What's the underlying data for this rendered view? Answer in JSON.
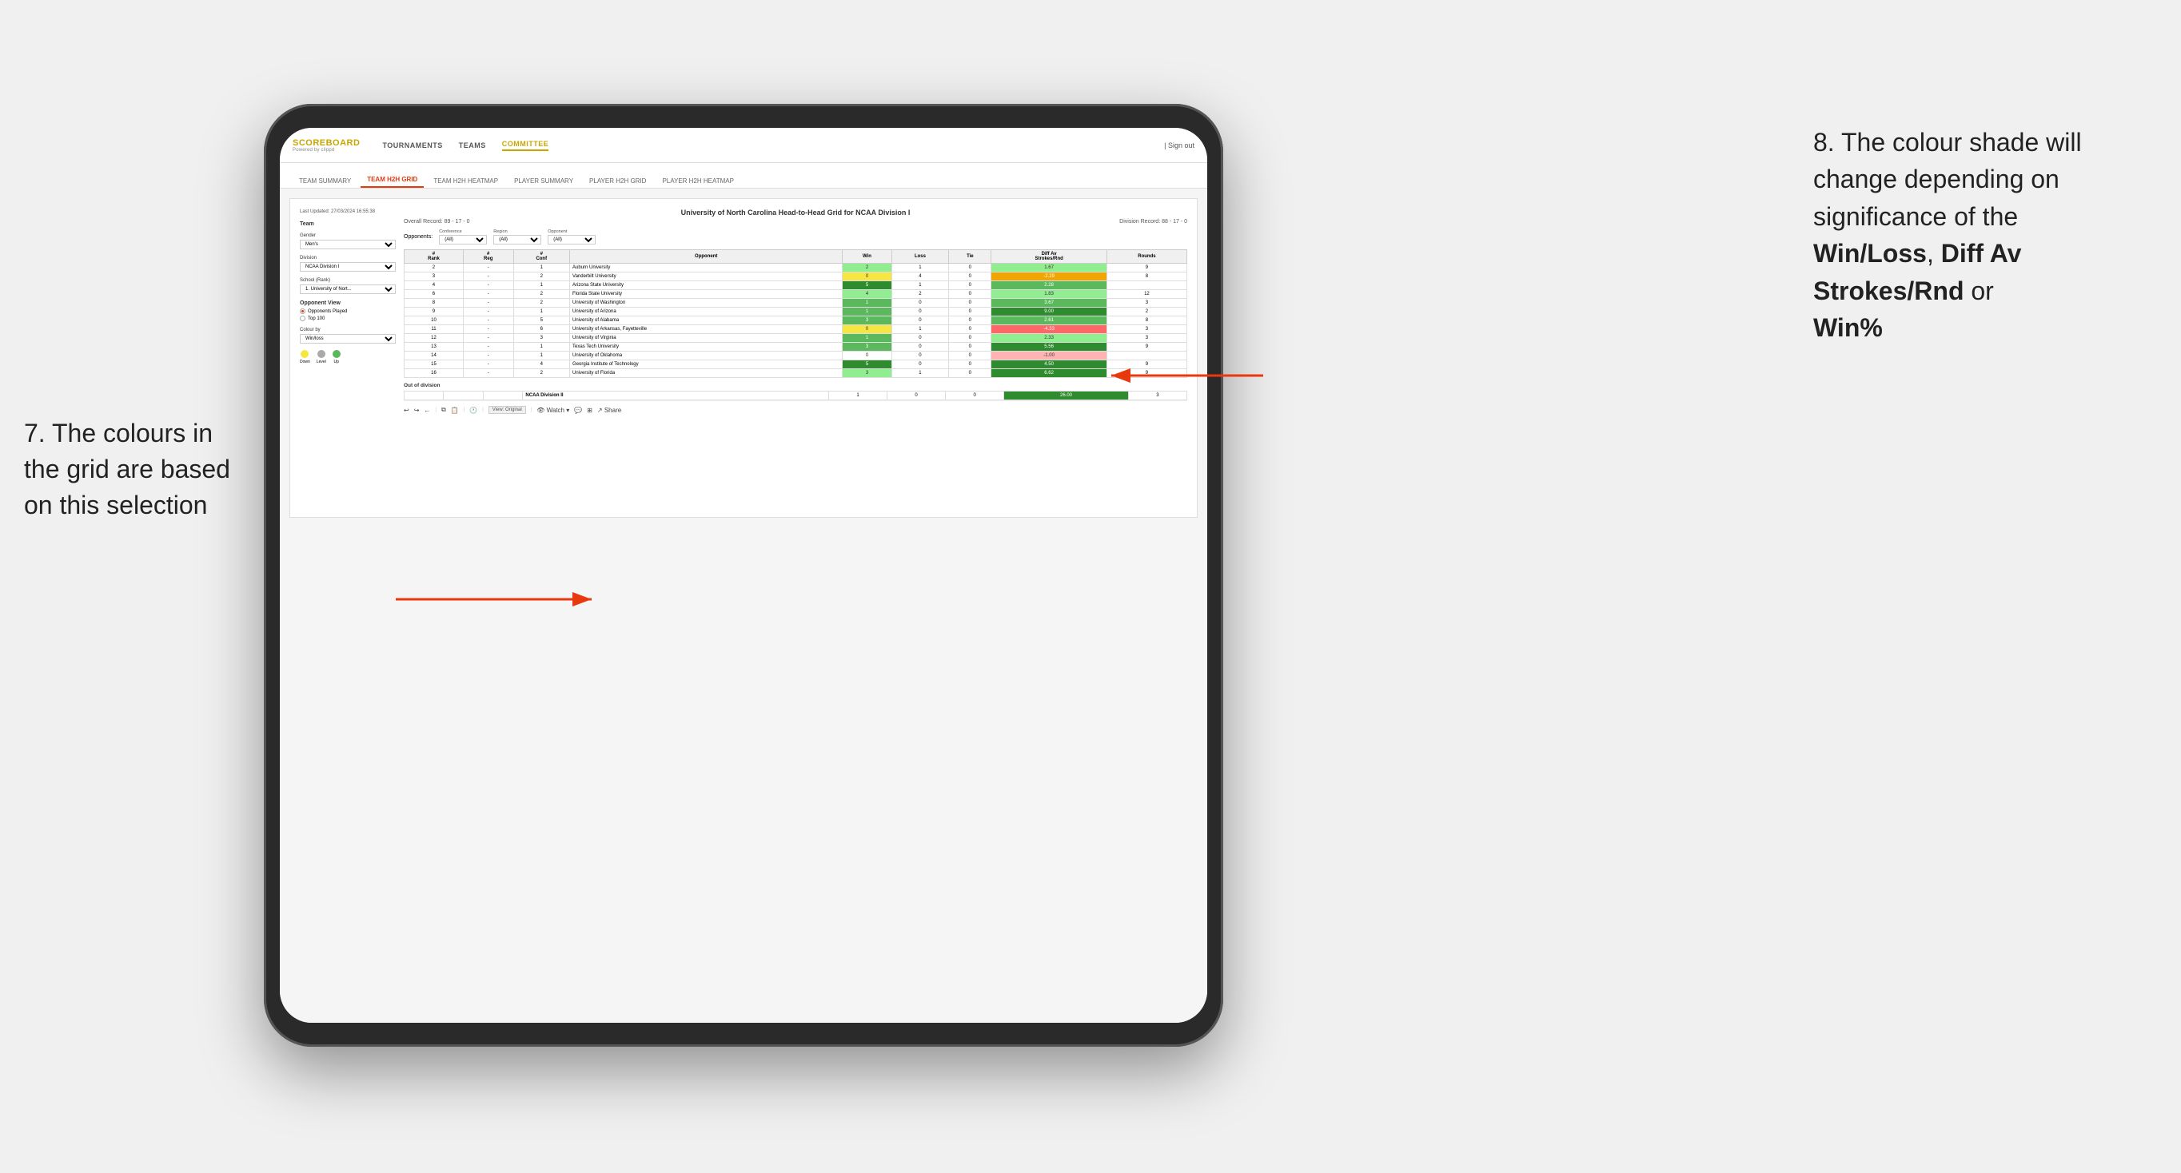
{
  "annotations": {
    "left_title": "7. The colours in the grid are based on this selection",
    "right_title": "8. The colour shade will change depending on significance of the",
    "right_bold1": "Win/Loss",
    "right_comma": ", ",
    "right_bold2": "Diff Av Strokes/Rnd",
    "right_or": " or",
    "right_bold3": "Win%"
  },
  "header": {
    "logo": "SCOREBOARD",
    "logo_sub": "Powered by clippd",
    "nav": [
      "TOURNAMENTS",
      "TEAMS",
      "COMMITTEE"
    ],
    "active_nav": "COMMITTEE",
    "sign_out": "Sign out"
  },
  "sub_nav": {
    "items": [
      "TEAM SUMMARY",
      "TEAM H2H GRID",
      "TEAM H2H HEATMAP",
      "PLAYER SUMMARY",
      "PLAYER H2H GRID",
      "PLAYER H2H HEATMAP"
    ],
    "active": "TEAM H2H GRID"
  },
  "report": {
    "last_updated": "Last Updated: 27/03/2024\n16:55:38",
    "title": "University of North Carolina Head-to-Head Grid for NCAA Division I",
    "overall_record": "Overall Record: 89 - 17 - 0",
    "division_record": "Division Record: 88 - 17 - 0",
    "sidebar": {
      "team_label": "Team",
      "gender_label": "Gender",
      "gender_value": "Men's",
      "division_label": "Division",
      "division_value": "NCAA Division I",
      "school_label": "School (Rank)",
      "school_value": "1. University of Nort...",
      "opponent_view_label": "Opponent View",
      "opponent_view_options": [
        "Opponents Played",
        "Top 100"
      ],
      "opponent_view_selected": "Opponents Played",
      "colour_by_label": "Colour by",
      "colour_by_value": "Win/loss",
      "legend": {
        "down_label": "Down",
        "level_label": "Level",
        "up_label": "Up",
        "down_color": "#f5e642",
        "level_color": "#aaaaaa",
        "up_color": "#5cb85c"
      }
    },
    "filters": {
      "conference_label": "Conference",
      "conference_value": "(All)",
      "region_label": "Region",
      "region_value": "(All)",
      "opponent_label": "Opponent",
      "opponent_value": "(All)",
      "opponents_label": "Opponents:"
    },
    "table_headers": [
      "#\nRank",
      "#\nReg",
      "#\nConf",
      "Opponent",
      "Win",
      "Loss",
      "Tie",
      "Diff Av\nStrokes/Rnd",
      "Rounds"
    ],
    "rows": [
      {
        "rank": "2",
        "reg": "-",
        "conf": "1",
        "opponent": "Auburn University",
        "win": "2",
        "loss": "1",
        "tie": "0",
        "diff": "1.67",
        "rounds": "9",
        "win_color": "green-light",
        "diff_color": "green-light"
      },
      {
        "rank": "3",
        "reg": "-",
        "conf": "2",
        "opponent": "Vanderbilt University",
        "win": "0",
        "loss": "4",
        "tie": "0",
        "diff": "-2.29",
        "rounds": "8",
        "win_color": "yellow",
        "diff_color": "orange"
      },
      {
        "rank": "4",
        "reg": "-",
        "conf": "1",
        "opponent": "Arizona State University",
        "win": "5",
        "loss": "1",
        "tie": "0",
        "diff": "2.28",
        "rounds": "",
        "win_color": "green-dark",
        "diff_color": "green-mid"
      },
      {
        "rank": "6",
        "reg": "-",
        "conf": "2",
        "opponent": "Florida State University",
        "win": "4",
        "loss": "2",
        "tie": "0",
        "diff": "1.83",
        "rounds": "12",
        "win_color": "green-light",
        "diff_color": "green-light"
      },
      {
        "rank": "8",
        "reg": "-",
        "conf": "2",
        "opponent": "University of Washington",
        "win": "1",
        "loss": "0",
        "tie": "0",
        "diff": "3.67",
        "rounds": "3",
        "win_color": "green-mid",
        "diff_color": "green-mid"
      },
      {
        "rank": "9",
        "reg": "-",
        "conf": "1",
        "opponent": "University of Arizona",
        "win": "1",
        "loss": "0",
        "tie": "0",
        "diff": "9.00",
        "rounds": "2",
        "win_color": "green-mid",
        "diff_color": "green-dark"
      },
      {
        "rank": "10",
        "reg": "-",
        "conf": "5",
        "opponent": "University of Alabama",
        "win": "3",
        "loss": "0",
        "tie": "0",
        "diff": "2.61",
        "rounds": "8",
        "win_color": "green-mid",
        "diff_color": "green-mid"
      },
      {
        "rank": "11",
        "reg": "-",
        "conf": "6",
        "opponent": "University of Arkansas, Fayetteville",
        "win": "0",
        "loss": "1",
        "tie": "0",
        "diff": "-4.33",
        "rounds": "3",
        "win_color": "yellow",
        "diff_color": "red-mid"
      },
      {
        "rank": "12",
        "reg": "-",
        "conf": "3",
        "opponent": "University of Virginia",
        "win": "1",
        "loss": "0",
        "tie": "0",
        "diff": "2.33",
        "rounds": "3",
        "win_color": "green-mid",
        "diff_color": "green-light"
      },
      {
        "rank": "13",
        "reg": "-",
        "conf": "1",
        "opponent": "Texas Tech University",
        "win": "3",
        "loss": "0",
        "tie": "0",
        "diff": "5.56",
        "rounds": "9",
        "win_color": "green-mid",
        "diff_color": "green-dark"
      },
      {
        "rank": "14",
        "reg": "-",
        "conf": "1",
        "opponent": "University of Oklahoma",
        "win": "0",
        "loss": "0",
        "tie": "0",
        "diff": "-1.00",
        "rounds": "",
        "win_color": "white",
        "diff_color": "red-light"
      },
      {
        "rank": "15",
        "reg": "-",
        "conf": "4",
        "opponent": "Georgia Institute of Technology",
        "win": "5",
        "loss": "0",
        "tie": "0",
        "diff": "4.50",
        "rounds": "9",
        "win_color": "green-dark",
        "diff_color": "green-dark"
      },
      {
        "rank": "16",
        "reg": "-",
        "conf": "2",
        "opponent": "University of Florida",
        "win": "3",
        "loss": "1",
        "tie": "0",
        "diff": "6.62",
        "rounds": "9",
        "win_color": "green-light",
        "diff_color": "green-dark"
      }
    ],
    "out_of_division": {
      "label": "Out of division",
      "rows": [
        {
          "rank": "",
          "reg": "",
          "conf": "",
          "opponent": "NCAA Division II",
          "win": "1",
          "loss": "0",
          "tie": "0",
          "diff": "26.00",
          "rounds": "3",
          "diff_color": "green-dark"
        }
      ]
    },
    "toolbar": {
      "view_label": "View: Original",
      "watch_label": "Watch ▾",
      "share_label": "Share"
    }
  }
}
